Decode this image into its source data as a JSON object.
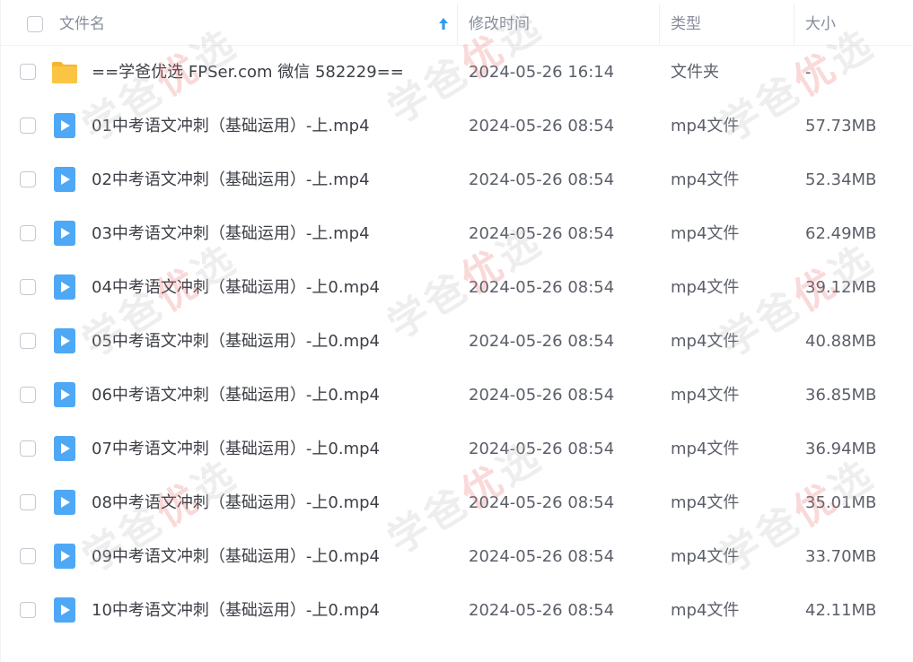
{
  "header": {
    "name_label": "文件名",
    "time_label": "修改时间",
    "type_label": "类型",
    "size_label": "大小",
    "sort_icon": "sort-arrow-up-icon"
  },
  "watermark": {
    "text_a": "学爸",
    "text_b": "优",
    "text_c": "选"
  },
  "files": [
    {
      "name": "==学爸优选 FPSer.com 微信 582229==",
      "time": "2024-05-26 16:14",
      "type": "文件夹",
      "size": "-",
      "icon": "folder-icon"
    },
    {
      "name": "01中考语文冲刺（基础运用）-上.mp4",
      "time": "2024-05-26 08:54",
      "type": "mp4文件",
      "size": "57.73MB",
      "icon": "video-file-icon"
    },
    {
      "name": "02中考语文冲刺（基础运用）-上.mp4",
      "time": "2024-05-26 08:54",
      "type": "mp4文件",
      "size": "52.34MB",
      "icon": "video-file-icon"
    },
    {
      "name": "03中考语文冲刺（基础运用）-上.mp4",
      "time": "2024-05-26 08:54",
      "type": "mp4文件",
      "size": "62.49MB",
      "icon": "video-file-icon"
    },
    {
      "name": "04中考语文冲刺（基础运用）-上0.mp4",
      "time": "2024-05-26 08:54",
      "type": "mp4文件",
      "size": "39.12MB",
      "icon": "video-file-icon"
    },
    {
      "name": "05中考语文冲刺（基础运用）-上0.mp4",
      "time": "2024-05-26 08:54",
      "type": "mp4文件",
      "size": "40.88MB",
      "icon": "video-file-icon"
    },
    {
      "name": "06中考语文冲刺（基础运用）-上0.mp4",
      "time": "2024-05-26 08:54",
      "type": "mp4文件",
      "size": "36.85MB",
      "icon": "video-file-icon"
    },
    {
      "name": "07中考语文冲刺（基础运用）-上0.mp4",
      "time": "2024-05-26 08:54",
      "type": "mp4文件",
      "size": "36.94MB",
      "icon": "video-file-icon"
    },
    {
      "name": "08中考语文冲刺（基础运用）-上0.mp4",
      "time": "2024-05-26 08:54",
      "type": "mp4文件",
      "size": "35.01MB",
      "icon": "video-file-icon"
    },
    {
      "name": "09中考语文冲刺（基础运用）-上0.mp4",
      "time": "2024-05-26 08:54",
      "type": "mp4文件",
      "size": "33.70MB",
      "icon": "video-file-icon"
    },
    {
      "name": "10中考语文冲刺（基础运用）-上0.mp4",
      "time": "2024-05-26 08:54",
      "type": "mp4文件",
      "size": "42.11MB",
      "icon": "video-file-icon"
    }
  ],
  "colors": {
    "folder": "#fbc544",
    "video": "#4fa8f5",
    "sort_arrow": "#2f9cf4"
  }
}
